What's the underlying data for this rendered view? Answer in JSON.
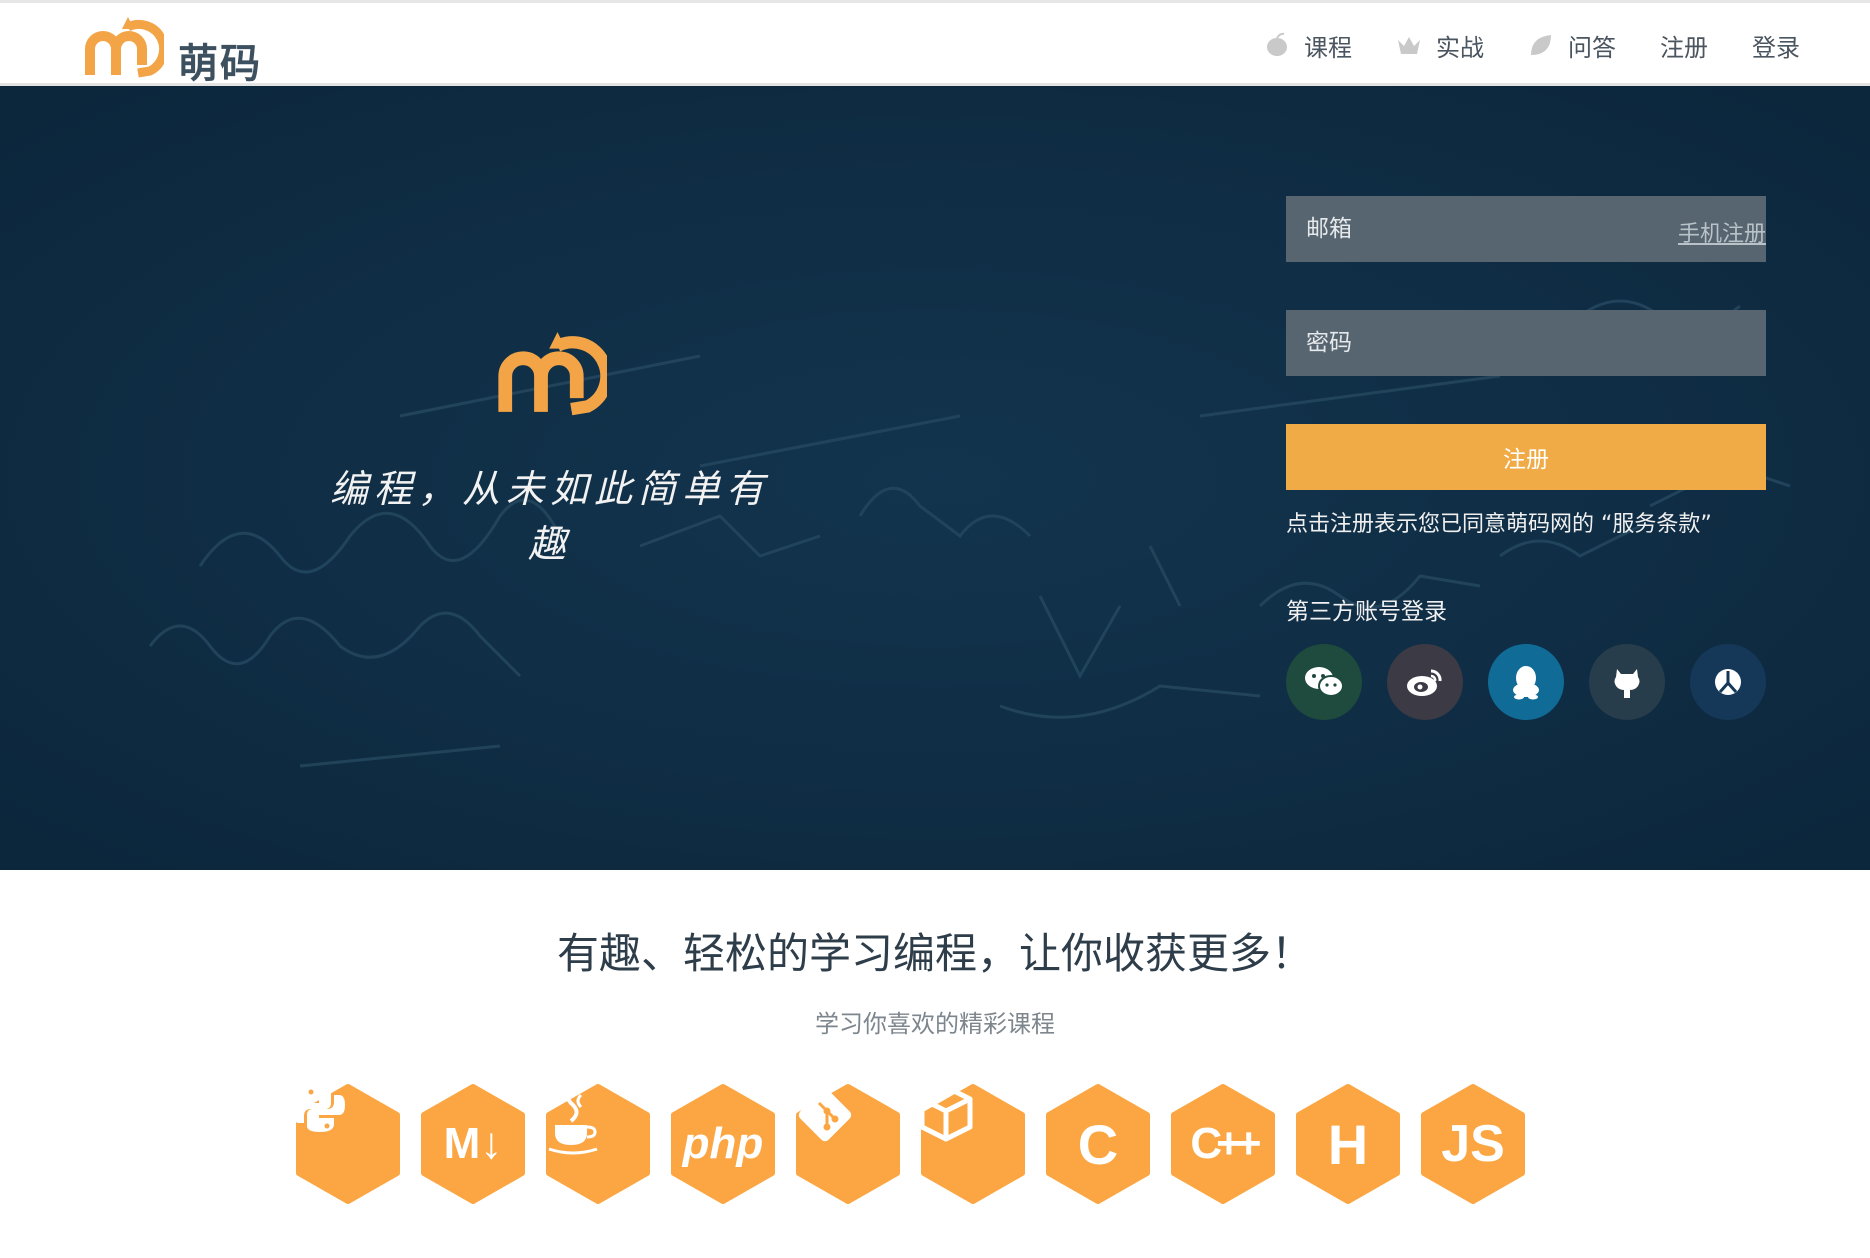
{
  "header": {
    "brand": "萌码",
    "nav": [
      {
        "label": "课程",
        "icon": "apple-icon"
      },
      {
        "label": "实战",
        "icon": "crown-icon"
      },
      {
        "label": "问答",
        "icon": "leaf-icon"
      },
      {
        "label": "注册",
        "icon": ""
      },
      {
        "label": "登录",
        "icon": ""
      }
    ]
  },
  "hero": {
    "slogan": "编程，从未如此简单有趣",
    "form": {
      "email_placeholder": "邮箱",
      "phone_register_link": "手机注册",
      "password_placeholder": "密码",
      "register_button": "注册",
      "agreement": "点击注册表示您已同意萌码网的 “服务条款”",
      "third_party_title": "第三方账号登录",
      "third_party": [
        {
          "name": "wechat",
          "color": "#1f4a3e"
        },
        {
          "name": "weibo",
          "color": "#3b3a45"
        },
        {
          "name": "qq",
          "color": "#106c97"
        },
        {
          "name": "github",
          "color": "#283d4b"
        },
        {
          "name": "baidu",
          "color": "#163858"
        }
      ]
    }
  },
  "main": {
    "tagline": "有趣、轻松的学习编程，让你收获更多！",
    "subtitle": "学习你喜欢的精彩课程",
    "languages": [
      {
        "name": "python-icon",
        "label": ""
      },
      {
        "name": "markdown-icon",
        "label": "M↓"
      },
      {
        "name": "java-icon",
        "label": ""
      },
      {
        "name": "php-icon",
        "label": "php"
      },
      {
        "name": "git-icon",
        "label": ""
      },
      {
        "name": "cube-icon",
        "label": ""
      },
      {
        "name": "c-icon",
        "label": "C"
      },
      {
        "name": "cpp-icon",
        "label": "C++"
      },
      {
        "name": "html-icon",
        "label": "H"
      },
      {
        "name": "js-icon",
        "label": "JS"
      }
    ]
  },
  "colors": {
    "accent": "#f0ab46",
    "hero_bg": "#0e2c43",
    "hex_orange": "#fba642"
  }
}
